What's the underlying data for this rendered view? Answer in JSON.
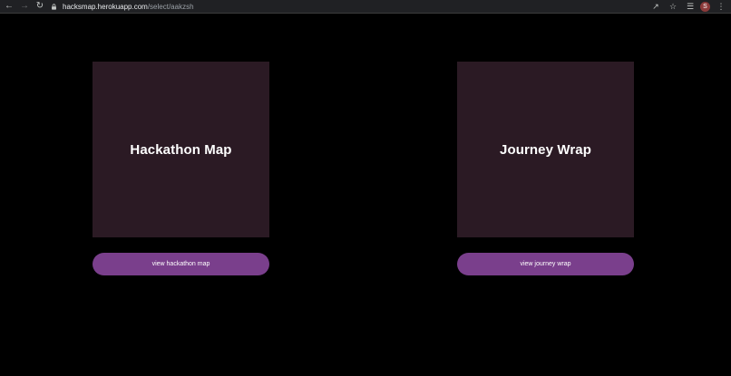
{
  "browser": {
    "url_host": "hacksmap.herokuapp.com",
    "url_path": "/select/aakzsh",
    "profile_initial": "S"
  },
  "cards": [
    {
      "title": "Hackathon Map",
      "button_label": "view hackathon map"
    },
    {
      "title": "Journey Wrap",
      "button_label": "view journey wrap"
    }
  ],
  "colors": {
    "card_bg": "#2b1a24",
    "button_bg": "#7a3f8c",
    "page_bg": "#000000"
  }
}
